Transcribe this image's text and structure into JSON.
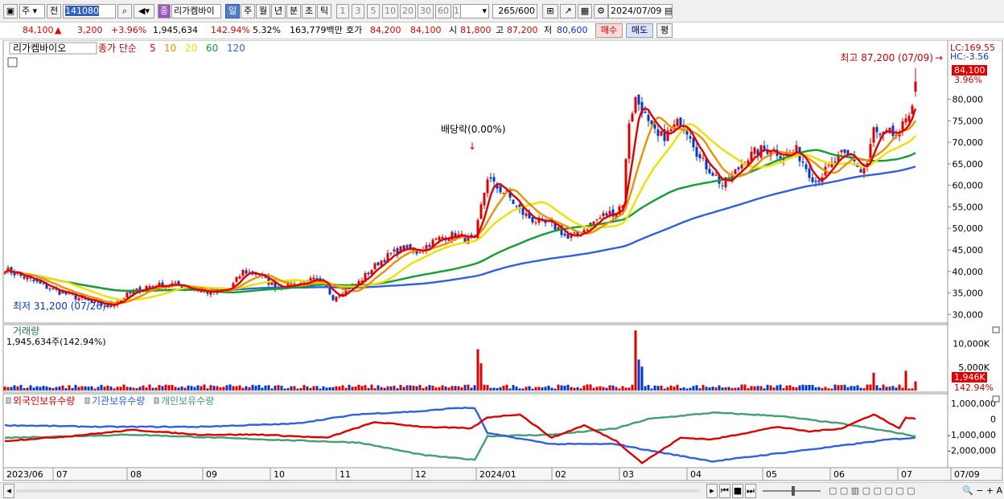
{
  "toolbar": {
    "mode": "주",
    "prev_label": "전",
    "code": "141080",
    "stock_name": "리가켐바이",
    "stock_prefix": "종",
    "periods": [
      "일",
      "주",
      "월",
      "년",
      "분",
      "초",
      "틱"
    ],
    "active_period": "일",
    "intervals": [
      "1",
      "3",
      "5",
      "10",
      "20",
      "30",
      "60",
      "120"
    ],
    "count": "265",
    "count_max": "/600",
    "date": "2024/07/09"
  },
  "quote": {
    "price": "84,100",
    "change": "3,200",
    "change_pct": "+3.96%",
    "volume": "1,945,634",
    "volume_ratio": "142.94%",
    "turnover": "5.32%",
    "amount": "163,779백만",
    "hoga_label": "호가",
    "ask": "84,200",
    "bid": "84,100",
    "open_label": "시",
    "open": "81,800",
    "high_label": "고",
    "high": "87,200",
    "low_label": "저",
    "low": "80,600",
    "buy_label": "매수",
    "sell_label": "매도",
    "flat_label": "평"
  },
  "legend": {
    "name": "리가켐바이오",
    "price_label": "종가 단순",
    "ma_periods": [
      "5",
      "10",
      "20",
      "60",
      "120"
    ]
  },
  "annotations": {
    "high": "최고 87,200 (07/09)",
    "low": "최저 31,200 (07/26)",
    "dividend": "배당락(0.00%)",
    "lc": "LC:169.55",
    "hc": "HC:-3.56",
    "last_price": "84,100",
    "last_pct": "3.96%",
    "volume_title": "거래량",
    "volume_value": "1,945,634주(142.94%)",
    "volume_last": "1,946K",
    "volume_pct": "142.94%"
  },
  "holdings_legend": [
    "외국인보유수량",
    "기관보유수량",
    "개인보유수량"
  ],
  "colors": {
    "up": "#e00000",
    "down": "#0038c8",
    "ma5": "#e00000",
    "ma10": "#f09000",
    "ma20": "#f0e000",
    "ma60": "#10a030",
    "ma120": "#3060e0",
    "foreign": "#e00000",
    "institution": "#3060e0",
    "individual": "#40a070"
  },
  "chart_data": [
    {
      "type": "candlestick",
      "title": "리가켐바이오",
      "ylabel": "",
      "ylim": [
        28000,
        93000
      ],
      "yticks": [
        30000,
        35000,
        40000,
        45000,
        50000,
        55000,
        60000,
        65000,
        70000,
        75000,
        80000
      ],
      "ytick_labels": [
        "30,000",
        "35,000",
        "40,000",
        "45,000",
        "50,000",
        "55,000",
        "60,000",
        "65,000",
        "70,000",
        "75,000",
        "80,000"
      ],
      "x_months": [
        "2023/06",
        "07",
        "08",
        "09",
        "10",
        "11",
        "12",
        "2024/01",
        "02",
        "03",
        "04",
        "05",
        "06",
        "07",
        "07/09"
      ],
      "anchors": [
        [
          0,
          40500
        ],
        [
          8,
          38000
        ],
        [
          14,
          36000
        ],
        [
          22,
          34000
        ],
        [
          28,
          32500
        ],
        [
          32,
          32000
        ],
        [
          38,
          34500
        ],
        [
          44,
          36500
        ],
        [
          52,
          37000
        ],
        [
          58,
          36000
        ],
        [
          64,
          35000
        ],
        [
          70,
          36000
        ],
        [
          74,
          40000
        ],
        [
          78,
          39500
        ],
        [
          84,
          36500
        ],
        [
          90,
          37000
        ],
        [
          96,
          38000
        ],
        [
          100,
          36000
        ],
        [
          102,
          34000
        ],
        [
          106,
          36000
        ],
        [
          110,
          37500
        ],
        [
          116,
          42000
        ],
        [
          120,
          44000
        ],
        [
          124,
          45500
        ],
        [
          128,
          44500
        ],
        [
          132,
          46500
        ],
        [
          136,
          48000
        ],
        [
          140,
          48500
        ],
        [
          144,
          47500
        ],
        [
          146,
          47000
        ],
        [
          148,
          55000
        ],
        [
          150,
          62000
        ],
        [
          152,
          60000
        ],
        [
          156,
          58000
        ],
        [
          160,
          54000
        ],
        [
          164,
          52000
        ],
        [
          168,
          51000
        ],
        [
          172,
          50000
        ],
        [
          175,
          47500
        ],
        [
          178,
          48500
        ],
        [
          182,
          51000
        ],
        [
          186,
          53000
        ],
        [
          190,
          54000
        ],
        [
          192,
          56000
        ],
        [
          194,
          75000
        ],
        [
          196,
          80000
        ],
        [
          198,
          78000
        ],
        [
          200,
          74000
        ],
        [
          203,
          71000
        ],
        [
          206,
          72000
        ],
        [
          210,
          75000
        ],
        [
          213,
          72000
        ],
        [
          216,
          66000
        ],
        [
          220,
          63000
        ],
        [
          223,
          60000
        ],
        [
          226,
          62000
        ],
        [
          230,
          66000
        ],
        [
          234,
          68000
        ],
        [
          238,
          68500
        ],
        [
          242,
          67000
        ],
        [
          246,
          68000
        ],
        [
          250,
          63000
        ],
        [
          252,
          61000
        ],
        [
          256,
          64000
        ],
        [
          260,
          67000
        ],
        [
          264,
          66000
        ],
        [
          266,
          63000
        ],
        [
          268,
          65000
        ],
        [
          270,
          73000
        ],
        [
          272,
          71000
        ],
        [
          275,
          72000
        ],
        [
          278,
          71000
        ],
        [
          280,
          76000
        ],
        [
          282,
          79000
        ],
        [
          283,
          84100
        ]
      ],
      "last": {
        "open": 81800,
        "high": 87200,
        "low": 80600,
        "close": 84100
      },
      "moving_averages": [
        "MA5",
        "MA10",
        "MA20",
        "MA60",
        "MA120"
      ]
    },
    {
      "type": "bar",
      "title": "거래량",
      "ylim": [
        0,
        12000000
      ],
      "yticks": [
        5000000,
        10000000
      ],
      "ytick_labels": [
        "5,000K",
        "10,000K"
      ],
      "spikes": [
        [
          147,
          8800000
        ],
        [
          148,
          5800000
        ],
        [
          196,
          12800000
        ],
        [
          197,
          6600000
        ],
        [
          198,
          5100000
        ],
        [
          283,
          1945634
        ],
        [
          280,
          4200000
        ],
        [
          270,
          3800000
        ]
      ]
    },
    {
      "type": "line",
      "title": "보유수량",
      "ylim": [
        -3000000,
        1300000
      ],
      "yticks": [
        1000000,
        0,
        -1000000,
        -2000000
      ],
      "ytick_labels": [
        "1,000,000",
        "0",
        "-1,000,000",
        "-2,000,000"
      ],
      "series": [
        {
          "name": "외국인보유수량",
          "anchors": [
            [
              0,
              -1400000
            ],
            [
              20,
              -1100000
            ],
            [
              40,
              -700000
            ],
            [
              60,
              -1000000
            ],
            [
              80,
              -1000000
            ],
            [
              100,
              -1200000
            ],
            [
              115,
              -200000
            ],
            [
              130,
              -500000
            ],
            [
              145,
              -600000
            ],
            [
              150,
              100000
            ],
            [
              160,
              300000
            ],
            [
              170,
              -1200000
            ],
            [
              180,
              -400000
            ],
            [
              190,
              -1400000
            ],
            [
              198,
              -2800000
            ],
            [
              210,
              -1200000
            ],
            [
              220,
              -1300000
            ],
            [
              230,
              -900000
            ],
            [
              240,
              -500000
            ],
            [
              250,
              -800000
            ],
            [
              260,
              -600000
            ],
            [
              270,
              300000
            ],
            [
              278,
              -600000
            ],
            [
              280,
              100000
            ],
            [
              283,
              0
            ]
          ]
        },
        {
          "name": "기관보유수량",
          "anchors": [
            [
              0,
              -400000
            ],
            [
              30,
              -500000
            ],
            [
              60,
              -500000
            ],
            [
              90,
              -300000
            ],
            [
              110,
              300000
            ],
            [
              130,
              500000
            ],
            [
              140,
              700000
            ],
            [
              146,
              700000
            ],
            [
              150,
              -900000
            ],
            [
              170,
              -1600000
            ],
            [
              190,
              -1600000
            ],
            [
              200,
              -2000000
            ],
            [
              220,
              -2700000
            ],
            [
              240,
              -2200000
            ],
            [
              260,
              -1700000
            ],
            [
              275,
              -1300000
            ],
            [
              283,
              -1200000
            ]
          ]
        },
        {
          "name": "개인보유수량",
          "anchors": [
            [
              0,
              -1200000
            ],
            [
              40,
              -1000000
            ],
            [
              80,
              -1300000
            ],
            [
              110,
              -1500000
            ],
            [
              130,
              -2300000
            ],
            [
              146,
              -2600000
            ],
            [
              150,
              -1100000
            ],
            [
              170,
              -1000000
            ],
            [
              190,
              -600000
            ],
            [
              200,
              0
            ],
            [
              220,
              400000
            ],
            [
              240,
              200000
            ],
            [
              260,
              -300000
            ],
            [
              275,
              -800000
            ],
            [
              283,
              -1100000
            ]
          ]
        }
      ]
    }
  ]
}
